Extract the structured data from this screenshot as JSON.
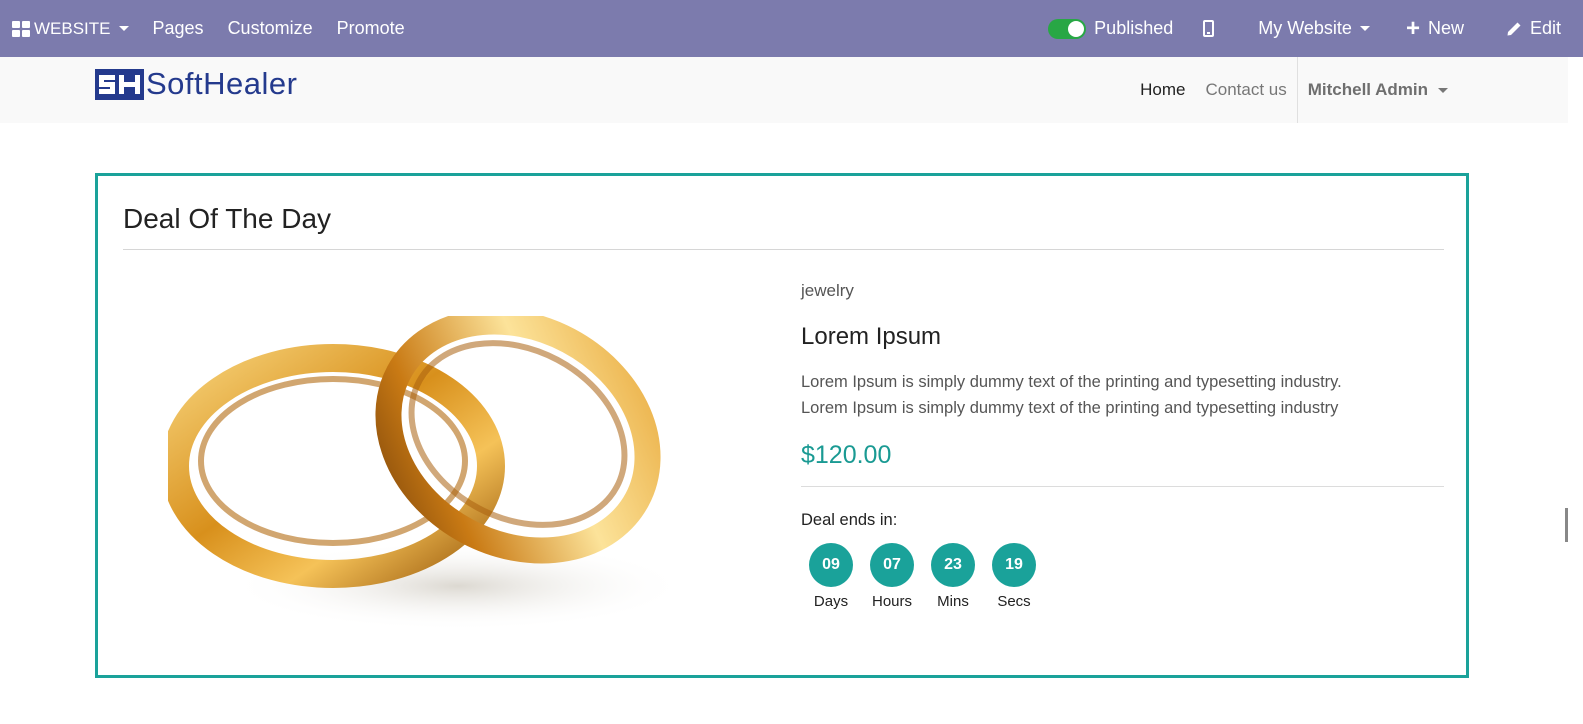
{
  "admin_bar": {
    "website_label": "WEBSITE",
    "menu": [
      "Pages",
      "Customize",
      "Promote"
    ],
    "published_label": "Published",
    "website_selector": "My Website",
    "new_label": "New",
    "edit_label": "Edit",
    "background": "#7c7bad"
  },
  "header": {
    "logo_text": "SoftHealer",
    "nav": {
      "home": "Home",
      "contact": "Contact us",
      "user": "Mitchell Admin"
    }
  },
  "deal": {
    "title": "Deal Of The Day",
    "category": "jewelry",
    "name": "Lorem Ipsum",
    "description_1": "Lorem Ipsum is simply dummy text of the printing and typesetting industry.",
    "description_2": "Lorem Ipsum is simply dummy text of the printing and typesetting industry",
    "price": "$120.00",
    "ends_label": "Deal ends in:",
    "countdown": [
      {
        "value": "09",
        "label": "Days"
      },
      {
        "value": "07",
        "label": "Hours"
      },
      {
        "value": "23",
        "label": "Mins"
      },
      {
        "value": "19",
        "label": "Secs"
      }
    ],
    "accent_color": "#1aa29a"
  }
}
